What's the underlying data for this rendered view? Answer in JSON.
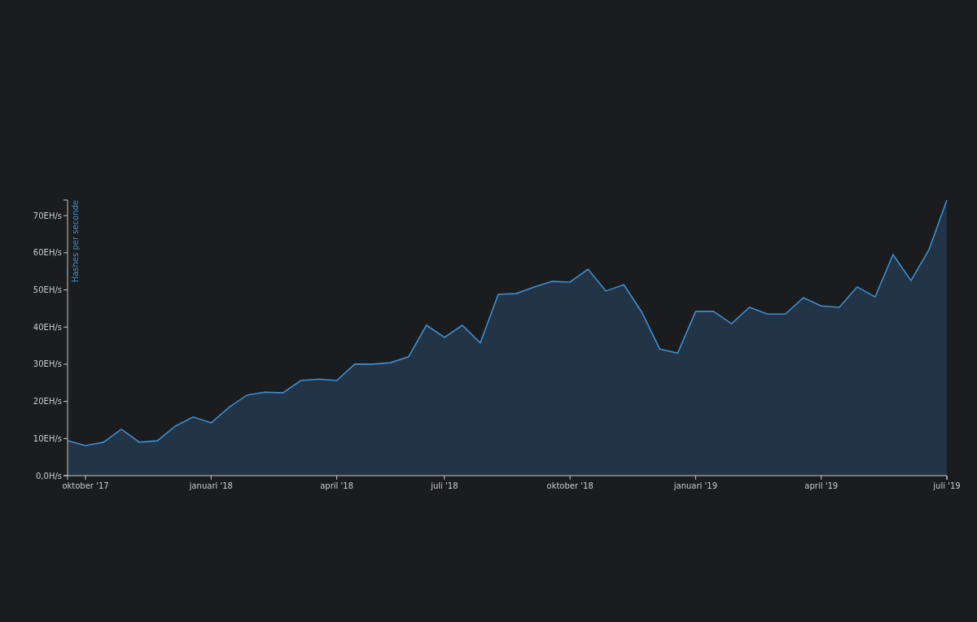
{
  "chart_data": {
    "type": "area",
    "ylabel": "Hashes per seconde",
    "categories": [
      null,
      "oktober '17",
      null,
      null,
      null,
      null,
      null,
      null,
      "januari '18",
      null,
      null,
      null,
      null,
      null,
      null,
      "april '18",
      null,
      null,
      null,
      null,
      null,
      "juli '18",
      null,
      null,
      null,
      null,
      null,
      null,
      "oktober '18",
      null,
      null,
      null,
      null,
      null,
      null,
      "januari '19",
      null,
      null,
      null,
      null,
      null,
      null,
      "april '19",
      null,
      null,
      null,
      null,
      null,
      null,
      "juli '19"
    ],
    "series": [
      {
        "color": "#3d8fd1",
        "values": [
          9.4,
          8.1,
          9.0,
          12.5,
          9.0,
          9.4,
          13.3,
          15.8,
          14.2,
          18.4,
          21.7,
          22.5,
          22.3,
          25.6,
          26.0,
          25.6,
          30.0,
          30.0,
          30.4,
          32.0,
          40.5,
          37.2,
          40.5,
          35.7,
          48.8,
          49.0,
          50.8,
          52.3,
          52.1,
          55.6,
          49.7,
          51.4,
          44.0,
          34.1,
          33.0,
          44.2,
          44.2,
          40.9,
          45.3,
          43.5,
          43.5,
          47.9,
          45.7,
          45.3,
          50.8,
          48.1,
          59.5,
          52.5,
          60.8,
          74.2
        ]
      }
    ],
    "ylim": [
      0,
      74.2
    ],
    "yticks": [
      {
        "value": 0,
        "label": "0,0H/s"
      },
      {
        "value": 10,
        "label": "10EH/s"
      },
      {
        "value": 20,
        "label": "20EH/s"
      },
      {
        "value": 30,
        "label": "30EH/s"
      },
      {
        "value": 40,
        "label": "40EH/s"
      },
      {
        "value": 50,
        "label": "50EH/s"
      },
      {
        "value": 60,
        "label": "60EH/s"
      },
      {
        "value": 70,
        "label": "70EH/s"
      }
    ]
  }
}
